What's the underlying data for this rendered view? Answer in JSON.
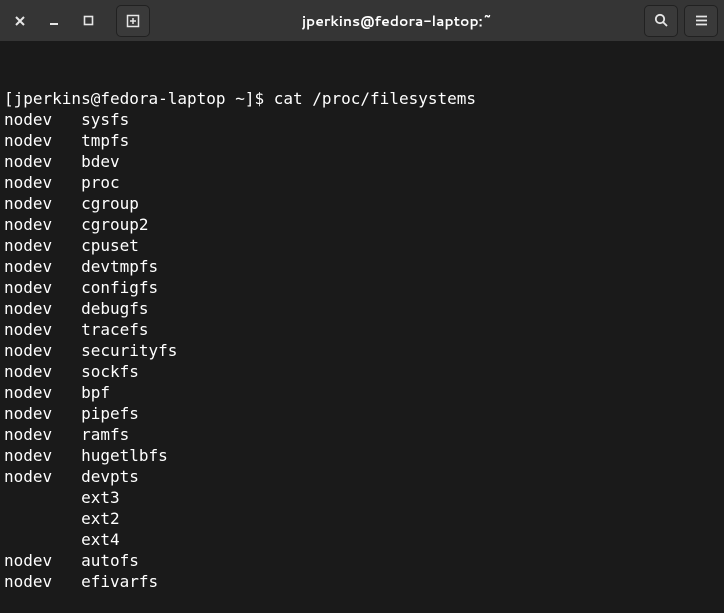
{
  "window": {
    "title": "jperkins@fedora-laptop:~"
  },
  "terminal": {
    "prompt": "[jperkins@fedora-laptop ~]$ ",
    "command": "cat /proc/filesystems",
    "rows": [
      {
        "col1": "nodev",
        "col2": "sysfs"
      },
      {
        "col1": "nodev",
        "col2": "tmpfs"
      },
      {
        "col1": "nodev",
        "col2": "bdev"
      },
      {
        "col1": "nodev",
        "col2": "proc"
      },
      {
        "col1": "nodev",
        "col2": "cgroup"
      },
      {
        "col1": "nodev",
        "col2": "cgroup2"
      },
      {
        "col1": "nodev",
        "col2": "cpuset"
      },
      {
        "col1": "nodev",
        "col2": "devtmpfs"
      },
      {
        "col1": "nodev",
        "col2": "configfs"
      },
      {
        "col1": "nodev",
        "col2": "debugfs"
      },
      {
        "col1": "nodev",
        "col2": "tracefs"
      },
      {
        "col1": "nodev",
        "col2": "securityfs"
      },
      {
        "col1": "nodev",
        "col2": "sockfs"
      },
      {
        "col1": "nodev",
        "col2": "bpf"
      },
      {
        "col1": "nodev",
        "col2": "pipefs"
      },
      {
        "col1": "nodev",
        "col2": "ramfs"
      },
      {
        "col1": "nodev",
        "col2": "hugetlbfs"
      },
      {
        "col1": "nodev",
        "col2": "devpts"
      },
      {
        "col1": "",
        "col2": "ext3"
      },
      {
        "col1": "",
        "col2": "ext2"
      },
      {
        "col1": "",
        "col2": "ext4"
      },
      {
        "col1": "nodev",
        "col2": "autofs"
      },
      {
        "col1": "nodev",
        "col2": "efivarfs"
      }
    ]
  }
}
